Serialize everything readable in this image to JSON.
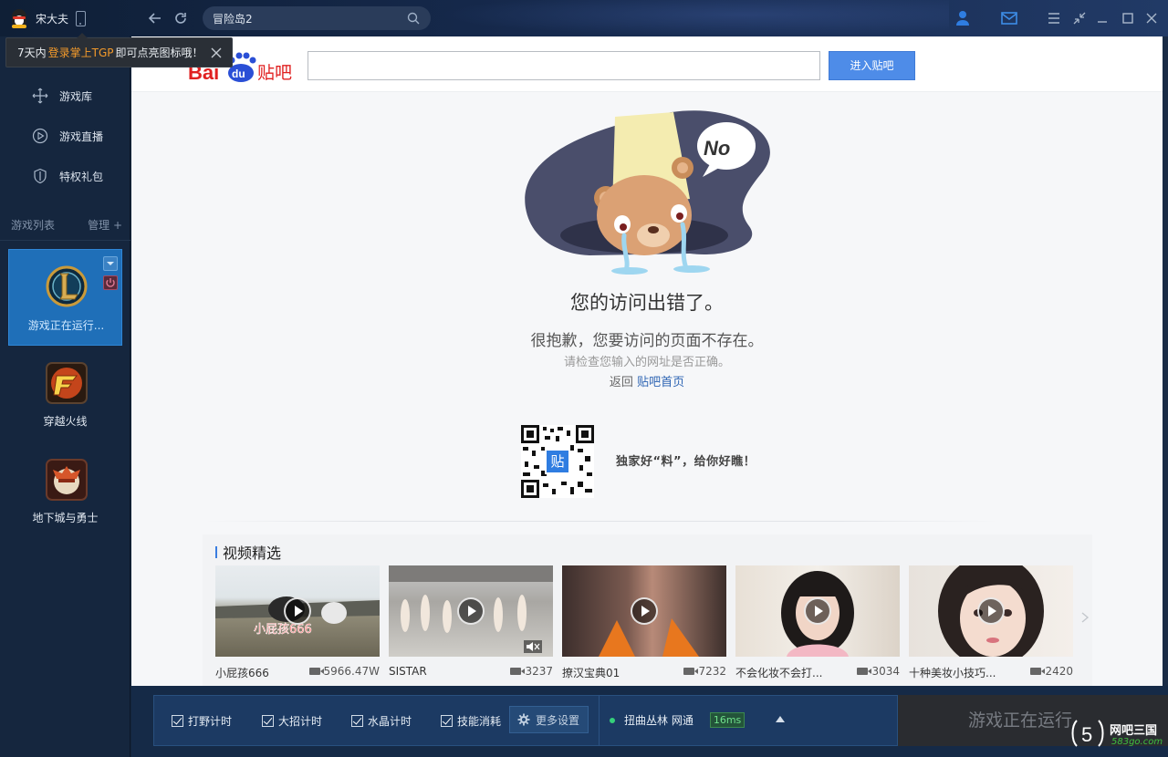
{
  "user": {
    "name": "宋大夫"
  },
  "address_bar": {
    "value": "冒险岛2"
  },
  "tooltip": {
    "prefix": "7天内",
    "highlight": "登录掌上TGP",
    "suffix": "即可点亮图标哦！"
  },
  "sidebar": {
    "nav": [
      {
        "label": "游戏库",
        "icon": "game-library-icon"
      },
      {
        "label": "游戏直播",
        "icon": "play-circle-icon"
      },
      {
        "label": "特权礼包",
        "icon": "shield-gift-icon"
      }
    ],
    "list_header": {
      "title": "游戏列表",
      "manage": "管理 +"
    },
    "games": [
      {
        "label": "游戏正在运行...",
        "icon": "league-of-legends-icon",
        "active": true
      },
      {
        "label": "穿越火线",
        "icon": "crossfire-icon",
        "active": false
      },
      {
        "label": "地下城与勇士",
        "icon": "dnf-icon",
        "active": false
      }
    ]
  },
  "page": {
    "logo_text": "Bai du 贴吧",
    "enter_button": "进入贴吧",
    "illustration_bubble": "No",
    "error_title": "您的访问出错了。",
    "error_subtitle": "很抱歉，您要访问的页面不存在。",
    "error_hint": "请检查您输入的网址是否正确。",
    "back_prefix": "返回",
    "back_link": "贴吧首页",
    "qr_badge": "贴",
    "qr_caption": "独家好“料”，给你好瞧！",
    "video_section_title": "视频精选",
    "videos": [
      {
        "title": "小屁孩666",
        "views": "5966.47W",
        "overlay": "小屁孩666"
      },
      {
        "title": "SISTAR",
        "views": "3237",
        "overlay": ""
      },
      {
        "title": "撩汉宝典01",
        "views": "7232",
        "overlay": ""
      },
      {
        "title": "不会化妆不会打...",
        "views": "3034",
        "overlay": ""
      },
      {
        "title": "十种美妆小技巧...",
        "views": "2420",
        "overlay": ""
      }
    ]
  },
  "bottom_bar": {
    "checks": [
      "打野计时",
      "大招计时",
      "水晶计时",
      "技能消耗"
    ],
    "more_settings": "更多设置",
    "server": "扭曲丛林 网通",
    "ping": "16ms",
    "running_button": "游戏正在运行"
  },
  "watermark": {
    "text": "网吧三国",
    "url": "583go.com",
    "mark": "5"
  },
  "colors": {
    "accent": "#1f6fb8",
    "highlight": "#f39a2b",
    "link": "#2d64b3",
    "enter_btn": "#4e8ce8",
    "ping_green": "#6fe08b"
  }
}
